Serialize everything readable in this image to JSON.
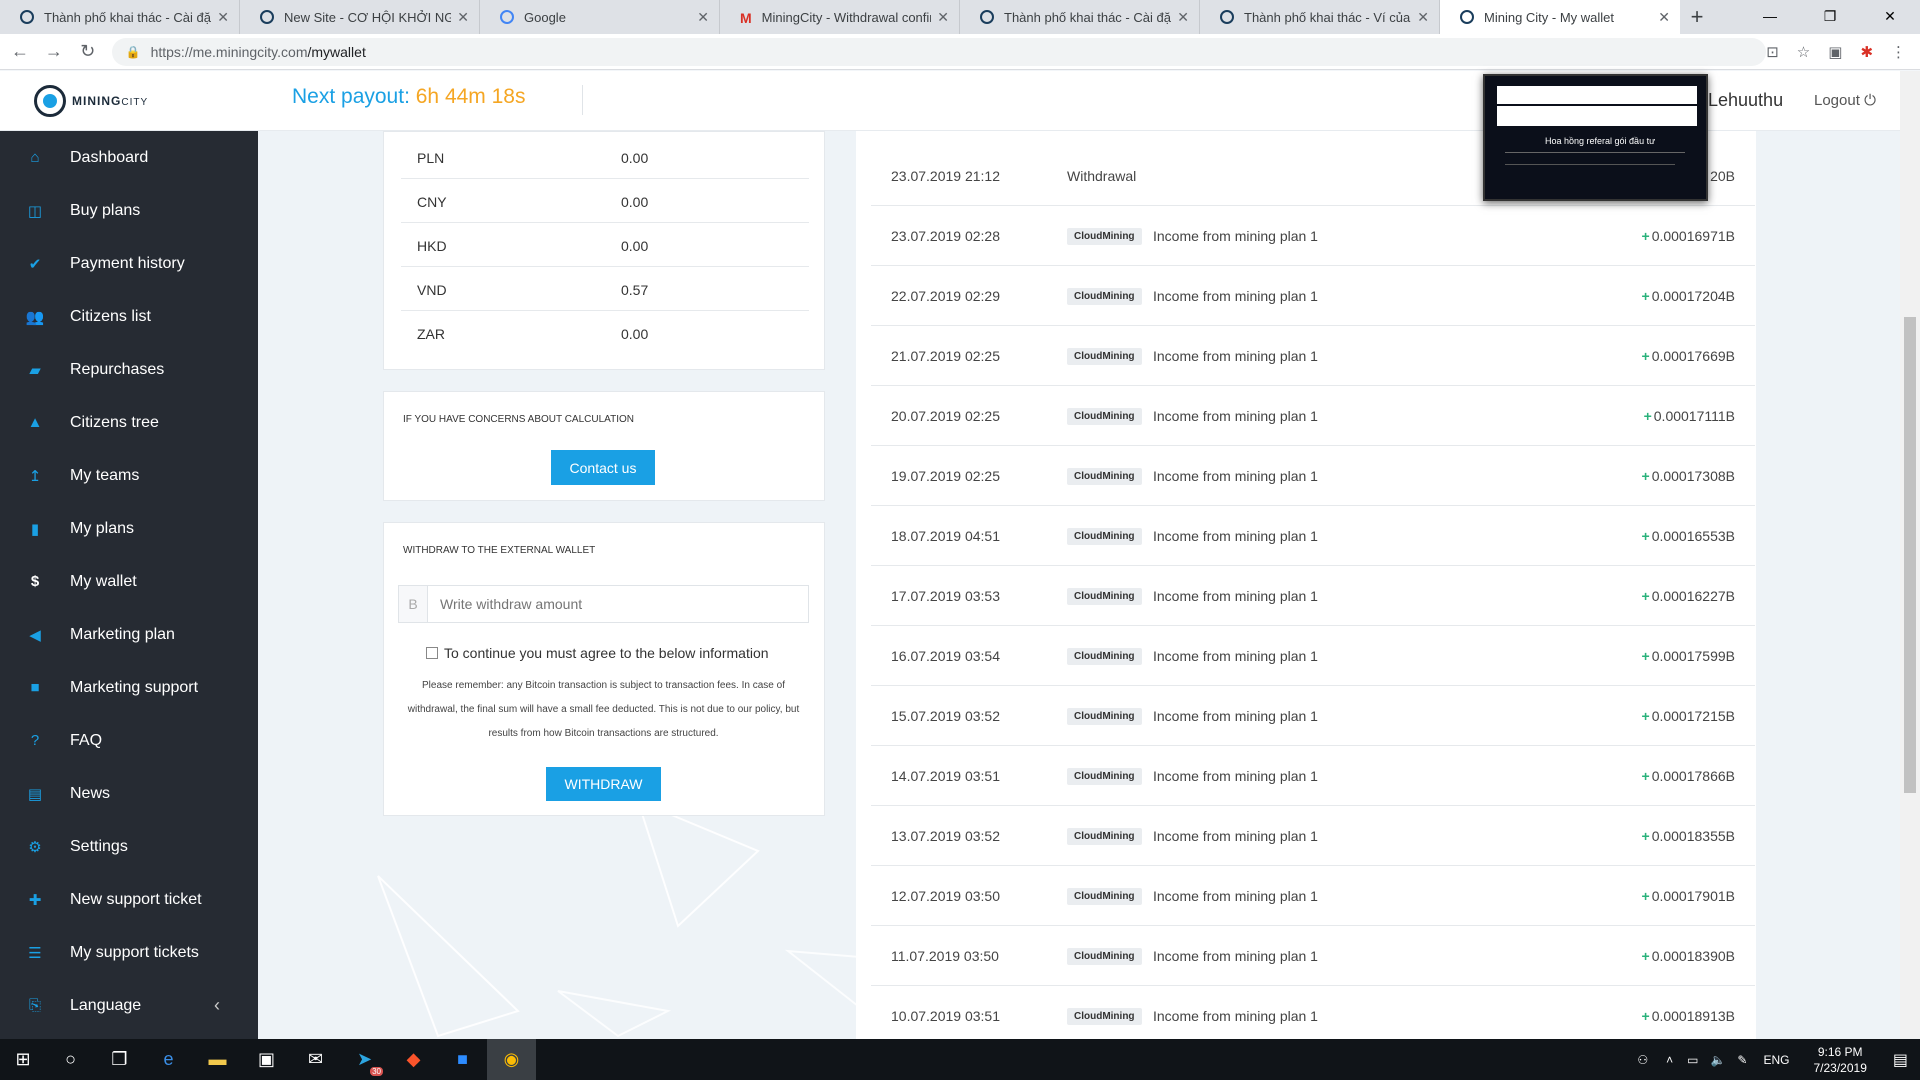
{
  "browser": {
    "tabs": [
      {
        "title": "Thành phố khai thác - Cài đặt",
        "icon": "miningcity-icon"
      },
      {
        "title": "New Site - CƠ HỘI KHỞI NGHIỆP",
        "icon": "site-icon"
      },
      {
        "title": "Google",
        "icon": "google-icon"
      },
      {
        "title": "MiningCity - Withdrawal confirm",
        "icon": "gmail-icon"
      },
      {
        "title": "Thành phố khai thác - Cài đặt",
        "icon": "miningcity-icon"
      },
      {
        "title": "Thành phố khai thác - Ví của tôi",
        "icon": "miningcity-icon"
      },
      {
        "title": "Mining City - My wallet",
        "icon": "miningcity-icon"
      }
    ],
    "url_host": "https://me.miningcity.com",
    "url_path": "/mywallet"
  },
  "header": {
    "logo_main": "MINING",
    "logo_sub": "CITY",
    "payout_label": "Next payout:",
    "payout_time": "6h 44m 18s",
    "username": "Lehuuthu",
    "logout": "Logout"
  },
  "popup": {
    "text": "Hoa hồng referal gói đầu tư"
  },
  "sidebar": {
    "items": [
      {
        "label": "Dashboard",
        "icon": "home-icon"
      },
      {
        "label": "Buy plans",
        "icon": "basket-icon"
      },
      {
        "label": "Payment history",
        "icon": "check-circle-icon"
      },
      {
        "label": "Citizens list",
        "icon": "users-icon"
      },
      {
        "label": "Repurchases",
        "icon": "briefcase-icon"
      },
      {
        "label": "Citizens tree",
        "icon": "tree-icon"
      },
      {
        "label": "My teams",
        "icon": "arrow-up-icon"
      },
      {
        "label": "My plans",
        "icon": "bookmark-icon"
      },
      {
        "label": "My wallet",
        "icon": "dollar-icon"
      },
      {
        "label": "Marketing plan",
        "icon": "megaphone-icon"
      },
      {
        "label": "Marketing support",
        "icon": "video-icon"
      },
      {
        "label": "FAQ",
        "icon": "question-icon"
      },
      {
        "label": "News",
        "icon": "newspaper-icon"
      },
      {
        "label": "Settings",
        "icon": "gear-icon"
      },
      {
        "label": "New support ticket",
        "icon": "plus-icon"
      },
      {
        "label": "My support tickets",
        "icon": "list-icon"
      },
      {
        "label": "Language",
        "icon": "language-icon"
      }
    ]
  },
  "currencies": [
    {
      "code": "PLN",
      "value": "0.00"
    },
    {
      "code": "CNY",
      "value": "0.00"
    },
    {
      "code": "HKD",
      "value": "0.00"
    },
    {
      "code": "VND",
      "value": "0.57"
    },
    {
      "code": "ZAR",
      "value": "0.00"
    }
  ],
  "concerns": {
    "heading": "IF YOU HAVE CONCERNS ABOUT CALCULATION",
    "button": "Contact us"
  },
  "withdraw": {
    "heading": "WITHDRAW TO THE EXTERNAL WALLET",
    "addon": "B",
    "placeholder": "Write withdraw amount",
    "agree": "To continue you must agree to the below information",
    "note": "Please remember: any Bitcoin transaction is subject to transaction fees. In case of withdrawal, the final sum will have a small fee deducted. This is not due to our policy, but results from how Bitcoin transactions are structured.",
    "button": "WITHDRAW"
  },
  "transactions": [
    {
      "date": "23.07.2019 21:12",
      "type": "Withdrawal",
      "badge": "",
      "desc": "",
      "sign": "",
      "amount": "20B"
    },
    {
      "date": "23.07.2019 02:28",
      "type": "",
      "badge": "CloudMining",
      "desc": "Income from mining plan 1",
      "sign": "+",
      "amount": "0.00016971B"
    },
    {
      "date": "22.07.2019 02:29",
      "type": "",
      "badge": "CloudMining",
      "desc": "Income from mining plan 1",
      "sign": "+",
      "amount": "0.00017204B"
    },
    {
      "date": "21.07.2019 02:25",
      "type": "",
      "badge": "CloudMining",
      "desc": "Income from mining plan 1",
      "sign": "+",
      "amount": "0.00017669B"
    },
    {
      "date": "20.07.2019 02:25",
      "type": "",
      "badge": "CloudMining",
      "desc": "Income from mining plan 1",
      "sign": "+",
      "amount": "0.00017111B"
    },
    {
      "date": "19.07.2019 02:25",
      "type": "",
      "badge": "CloudMining",
      "desc": "Income from mining plan 1",
      "sign": "+",
      "amount": "0.00017308B"
    },
    {
      "date": "18.07.2019 04:51",
      "type": "",
      "badge": "CloudMining",
      "desc": "Income from mining plan 1",
      "sign": "+",
      "amount": "0.00016553B"
    },
    {
      "date": "17.07.2019 03:53",
      "type": "",
      "badge": "CloudMining",
      "desc": "Income from mining plan 1",
      "sign": "+",
      "amount": "0.00016227B"
    },
    {
      "date": "16.07.2019 03:54",
      "type": "",
      "badge": "CloudMining",
      "desc": "Income from mining plan 1",
      "sign": "+",
      "amount": "0.00017599B"
    },
    {
      "date": "15.07.2019 03:52",
      "type": "",
      "badge": "CloudMining",
      "desc": "Income from mining plan 1",
      "sign": "+",
      "amount": "0.00017215B"
    },
    {
      "date": "14.07.2019 03:51",
      "type": "",
      "badge": "CloudMining",
      "desc": "Income from mining plan 1",
      "sign": "+",
      "amount": "0.00017866B"
    },
    {
      "date": "13.07.2019 03:52",
      "type": "",
      "badge": "CloudMining",
      "desc": "Income from mining plan 1",
      "sign": "+",
      "amount": "0.00018355B"
    },
    {
      "date": "12.07.2019 03:50",
      "type": "",
      "badge": "CloudMining",
      "desc": "Income from mining plan 1",
      "sign": "+",
      "amount": "0.00017901B"
    },
    {
      "date": "11.07.2019 03:50",
      "type": "",
      "badge": "CloudMining",
      "desc": "Income from mining plan 1",
      "sign": "+",
      "amount": "0.00018390B"
    },
    {
      "date": "10.07.2019 03:51",
      "type": "",
      "badge": "CloudMining",
      "desc": "Income from mining plan 1",
      "sign": "+",
      "amount": "0.00018913B"
    }
  ],
  "taskbar": {
    "telegram_badge": "30",
    "lang": "ENG",
    "time": "9:16 PM",
    "date": "7/23/2019"
  },
  "colors": {
    "accent": "#1aa0e4",
    "payout_time": "#f5a623",
    "sidebar_bg": "#262b33",
    "positive": "#2ab27b"
  }
}
